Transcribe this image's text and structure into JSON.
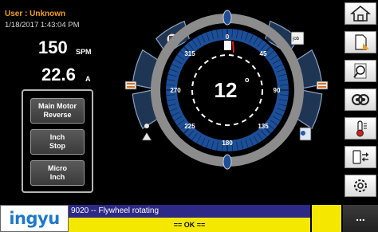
{
  "header": {
    "user": "User : Unknown",
    "datetime": "1/18/2017  1:43:04 PM"
  },
  "readouts": {
    "spm_value": "150",
    "spm_unit": "SPM",
    "amps_value": "22.6",
    "amps_unit": "A"
  },
  "buttons": {
    "main_motor_reverse": "Main Motor\nReverse",
    "inch_stop": "Inch\nStop",
    "micro_inch": "Micro\nInch"
  },
  "dial": {
    "angle_value": "12",
    "angle_unit": "o",
    "degree_labels": [
      "0",
      "45",
      "90",
      "135",
      "180",
      "225",
      "270",
      "315"
    ]
  },
  "sidebar": {
    "items": [
      {
        "name": "home",
        "icon": "home-icon"
      },
      {
        "name": "document",
        "icon": "document-icon"
      },
      {
        "name": "search",
        "icon": "search-icon"
      },
      {
        "name": "gears",
        "icon": "gears-icon"
      },
      {
        "name": "thermometer",
        "icon": "thermometer-icon"
      },
      {
        "name": "transfer",
        "icon": "transfer-icon"
      },
      {
        "name": "settings",
        "icon": "settings-icon"
      }
    ]
  },
  "footer": {
    "logo": "ingyu",
    "message": "9020  -- Flywheel rotating",
    "ok_label": "== OK ==",
    "more_label": "..."
  }
}
